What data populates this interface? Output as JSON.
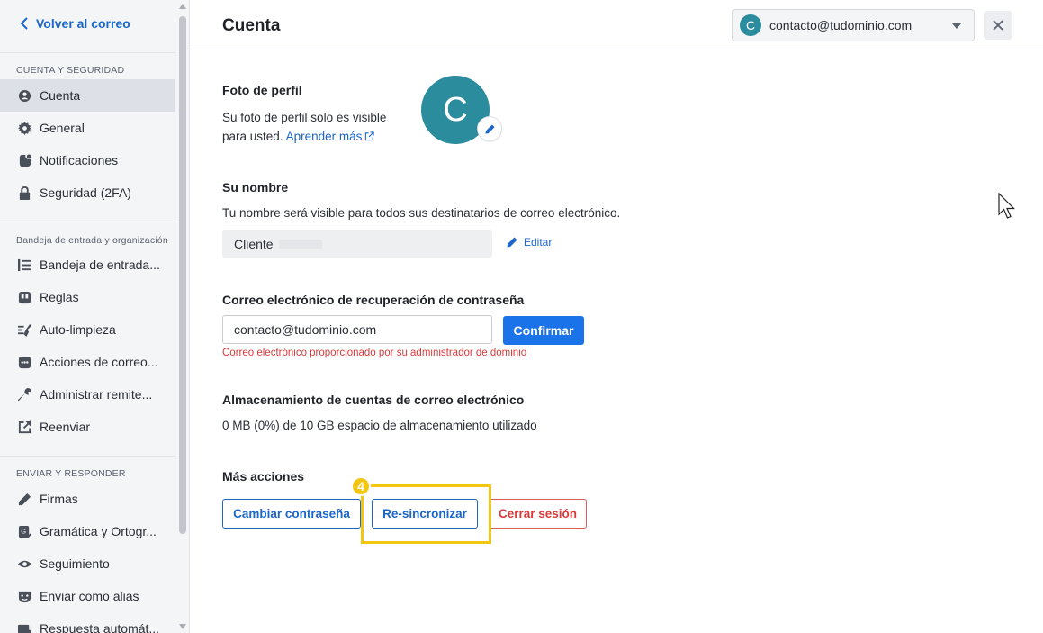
{
  "sidebar": {
    "back_label": "Volver al correo",
    "sections": [
      {
        "header": "CUENTA Y SEGURIDAD",
        "items": [
          {
            "label": "Cuenta",
            "icon": "user-circle-icon",
            "active": true
          },
          {
            "label": "General",
            "icon": "gear-icon"
          },
          {
            "label": "Notificaciones",
            "icon": "notification-icon"
          },
          {
            "label": "Seguridad (2FA)",
            "icon": "lock-icon"
          }
        ]
      },
      {
        "header": "Bandeja de entrada y organización",
        "items": [
          {
            "label": "Bandeja de entrada...",
            "icon": "list-order-icon"
          },
          {
            "label": "Reglas",
            "icon": "rules-icon"
          },
          {
            "label": "Auto-limpieza",
            "icon": "broom-icon"
          },
          {
            "label": "Acciones de correo...",
            "icon": "actions-icon"
          },
          {
            "label": "Administrar remite...",
            "icon": "wrench-icon"
          },
          {
            "label": "Reenviar",
            "icon": "forward-icon"
          }
        ]
      },
      {
        "header": "ENVIAR Y RESPONDER",
        "items": [
          {
            "label": "Firmas",
            "icon": "pen-icon"
          },
          {
            "label": "Gramática y Ortogr...",
            "icon": "grammar-icon"
          },
          {
            "label": "Seguimiento",
            "icon": "eye-icon"
          },
          {
            "label": "Enviar como alias",
            "icon": "mask-icon"
          },
          {
            "label": "Respuesta automát...",
            "icon": "auto-reply-icon"
          }
        ]
      }
    ]
  },
  "header": {
    "title": "Cuenta",
    "account_initial": "C",
    "account_email": "contacto@tudominio.com"
  },
  "profile_photo": {
    "title": "Foto de perfil",
    "description_line1": "Su foto de perfil solo es visible",
    "description_line2": "para usted.",
    "learn_more": "Aprender más",
    "avatar_initial": "C"
  },
  "name": {
    "title": "Su nombre",
    "description": "Tu nombre será visible para todos sus destinatarios de correo electrónico.",
    "value": "Cliente",
    "edit_label": "Editar"
  },
  "recovery": {
    "title": "Correo electrónico de recuperación de contraseña",
    "value": "contacto@tudominio.com",
    "confirm_label": "Confirmar",
    "error": "Correo electrónico proporcionado por su administrador de dominio"
  },
  "storage": {
    "title": "Almacenamiento de cuentas de correo electrónico",
    "usage": "0 MB (0%) de 10 GB espacio de almacenamiento utilizado"
  },
  "more_actions": {
    "title": "Más acciones",
    "change_password": "Cambiar contraseña",
    "resync": "Re-sincronizar",
    "logout": "Cerrar sesión",
    "step_number": "4"
  },
  "colors": {
    "accent": "#1a73e8",
    "link": "#1b66c9",
    "danger": "#d93b3b",
    "avatar": "#2b8c9e",
    "highlight": "#f2c611"
  }
}
